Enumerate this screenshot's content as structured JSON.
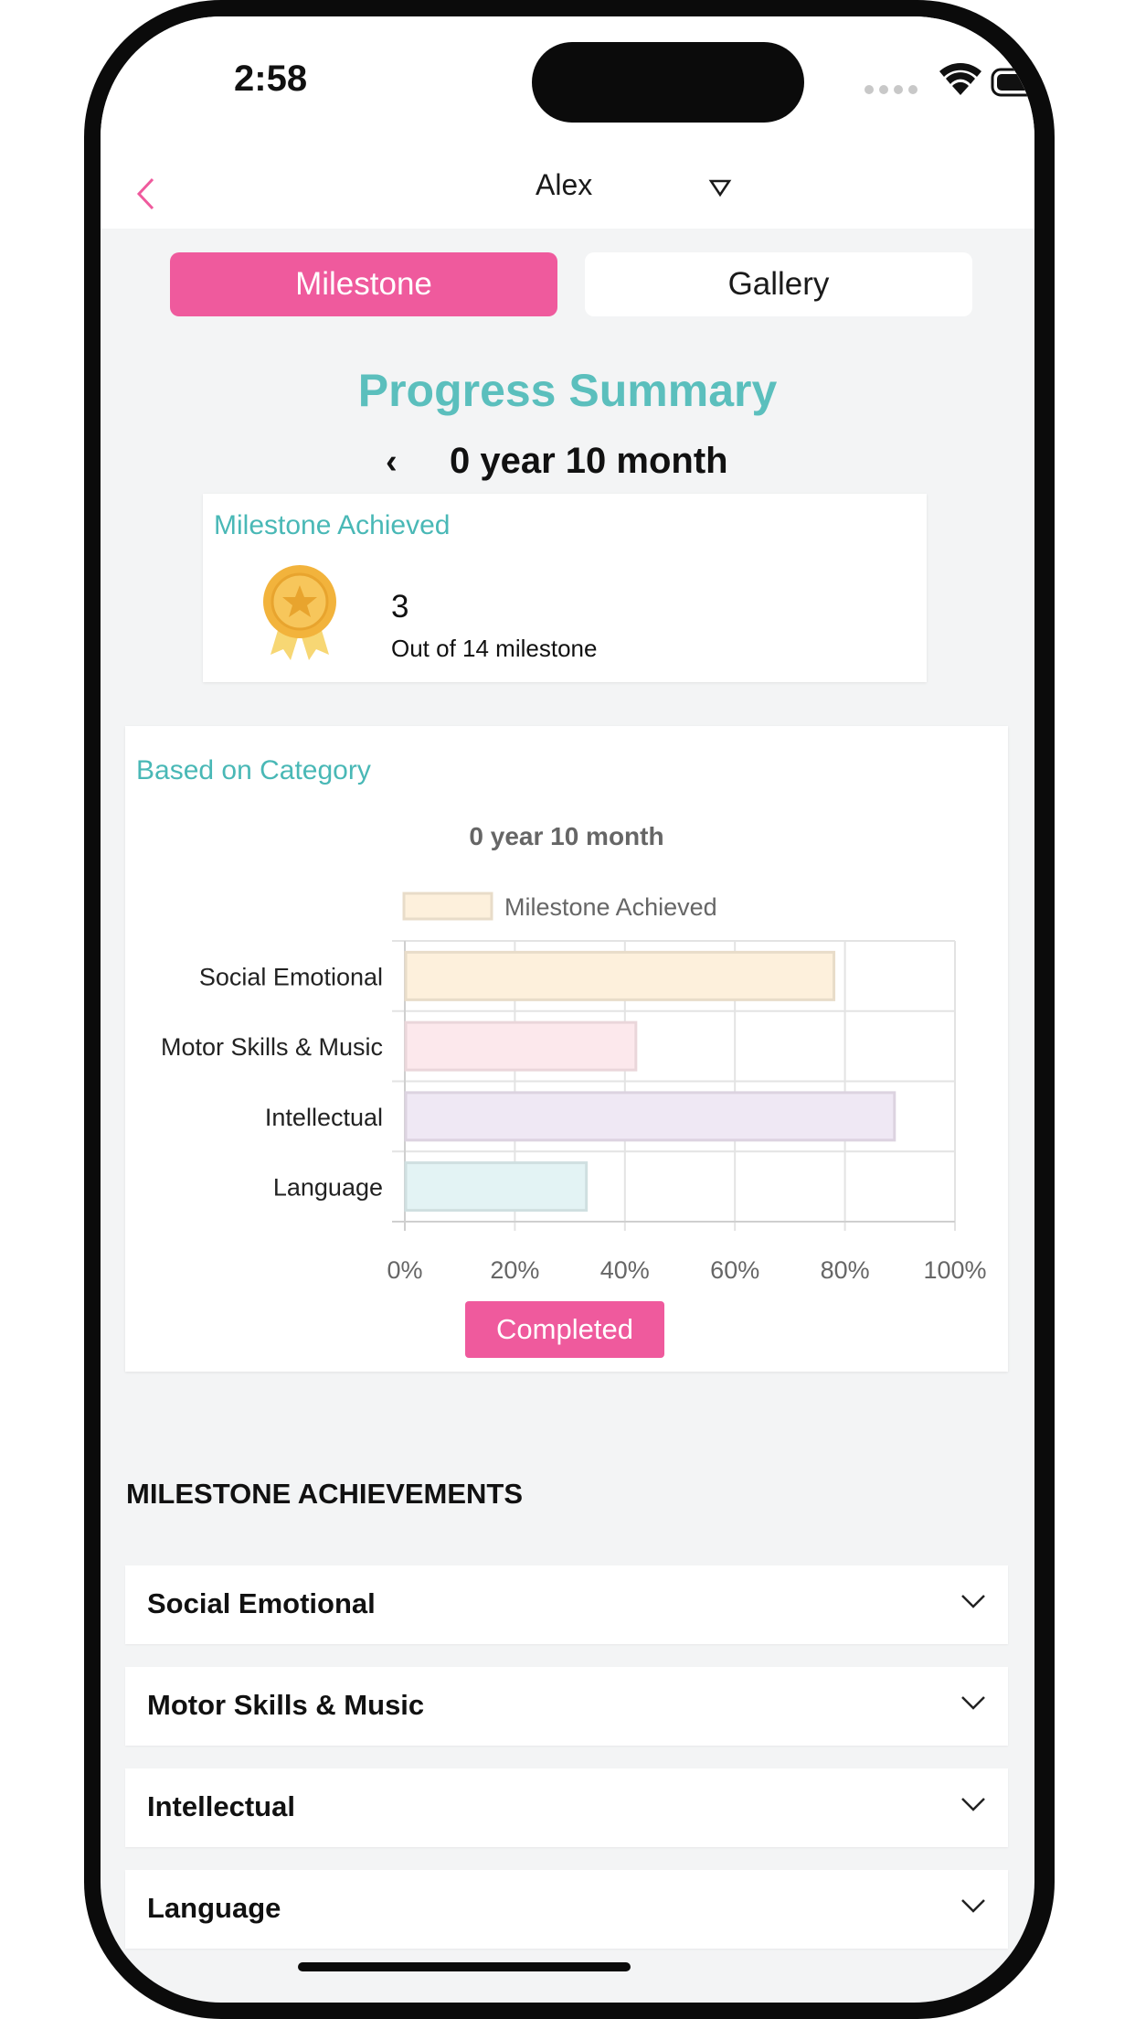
{
  "status_bar": {
    "time": "2:58"
  },
  "header": {
    "child_name": "Alex"
  },
  "tabs": [
    {
      "label": "Milestone",
      "active": true
    },
    {
      "label": "Gallery",
      "active": false
    }
  ],
  "summary": {
    "title": "Progress Summary",
    "period": "0 year 10 month"
  },
  "achieved_card": {
    "title": "Milestone Achieved",
    "count": "3",
    "subtitle": "Out of 14 milestone"
  },
  "category_card": {
    "title": "Based on Category",
    "button_label": "Completed"
  },
  "chart_data": {
    "type": "bar",
    "orientation": "horizontal",
    "title": "0 year 10 month",
    "categories": [
      "Social Emotional",
      "Motor Skills & Music",
      "Intellectual",
      "Language"
    ],
    "series": [
      {
        "name": "Milestone Achieved",
        "values": [
          78,
          42,
          89,
          33
        ]
      }
    ],
    "bar_colors": [
      "#fdf0dc",
      "#fce8ec",
      "#efe8f4",
      "#e3f3f4"
    ],
    "bar_border_colors": [
      "#e8dcc9",
      "#ead6da",
      "#dcd3e0",
      "#cfdfe0"
    ],
    "xlim": [
      0,
      100
    ],
    "x_ticks": [
      "0%",
      "20%",
      "40%",
      "60%",
      "80%",
      "100%"
    ],
    "legend_position": "top",
    "grid": true
  },
  "achievements": {
    "heading": "MILESTONE ACHIEVEMENTS",
    "items": [
      {
        "label": "Social Emotional"
      },
      {
        "label": "Motor Skills & Music"
      },
      {
        "label": "Intellectual"
      },
      {
        "label": "Language"
      }
    ]
  },
  "colors": {
    "accent_pink": "#ef5a9d",
    "accent_teal": "#5bbfbd",
    "background": "#f3f4f5"
  }
}
